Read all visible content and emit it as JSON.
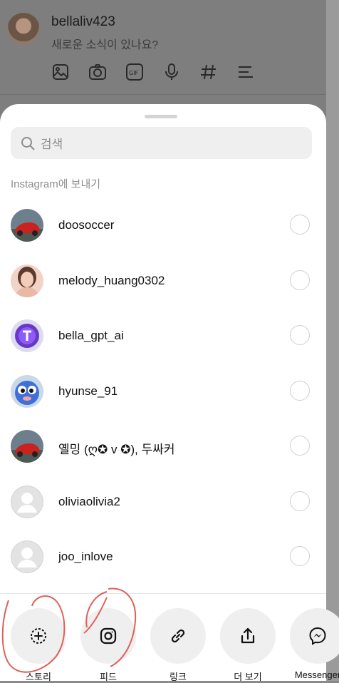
{
  "background": {
    "username": "bellaliv423",
    "prompt": "새로운 소식이 있나요?",
    "tools": [
      "gallery-icon",
      "camera-icon",
      "gif-icon",
      "mic-icon",
      "hashtag-icon",
      "list-icon"
    ]
  },
  "sheet": {
    "search_placeholder": "검색",
    "section_label": "Instagram에 보내기",
    "recipients": [
      {
        "username": "doosoccer",
        "avatar": "red-car"
      },
      {
        "username": "melody_huang0302",
        "avatar": "portrait"
      },
      {
        "username": "bella_gpt_ai",
        "avatar": "purple-logo"
      },
      {
        "username": "hyunse_91",
        "avatar": "blue-creature"
      },
      {
        "username": "옐밍 (ღ✪ v ✪), 두싸커",
        "avatar": "red-car"
      },
      {
        "username": "oliviaolivia2",
        "avatar": "default"
      },
      {
        "username": "joo_inlove",
        "avatar": "default"
      }
    ],
    "actions": [
      {
        "label": "스토리",
        "icon": "add-story-icon"
      },
      {
        "label": "피드",
        "icon": "instagram-icon"
      },
      {
        "label": "링크",
        "icon": "link-icon"
      },
      {
        "label": "더 보기",
        "icon": "share-icon"
      },
      {
        "label": "Messenger",
        "icon": "messenger-icon"
      }
    ]
  },
  "colors": {
    "sheet_bg": "#ffffff",
    "dim_bg": "#7e7e7e",
    "annotation_red": "#e0605a"
  }
}
